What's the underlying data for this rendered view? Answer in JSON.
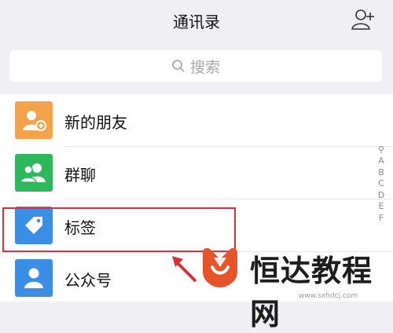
{
  "header": {
    "title": "通讯录",
    "add_contact_icon": "add-contact-icon"
  },
  "search": {
    "label": "搜索",
    "icon": "search-icon"
  },
  "contacts": {
    "items": [
      {
        "label": "新的朋友",
        "icon": "new-friend-icon",
        "color": "#f5a34b"
      },
      {
        "label": "群聊",
        "icon": "group-chat-icon",
        "color": "#2eb85c"
      },
      {
        "label": "标签",
        "icon": "tag-icon",
        "color": "#3a8ee6"
      },
      {
        "label": "公众号",
        "icon": "official-account-icon",
        "color": "#3a8ee6"
      }
    ]
  },
  "index_bar": [
    "A",
    "B",
    "C",
    "D",
    "E",
    "F"
  ],
  "highlight_color": "#d9303a",
  "watermark": {
    "text": "恒达教程网",
    "url": "www.sxhdcj.com",
    "logo_color": "#e8542a"
  }
}
